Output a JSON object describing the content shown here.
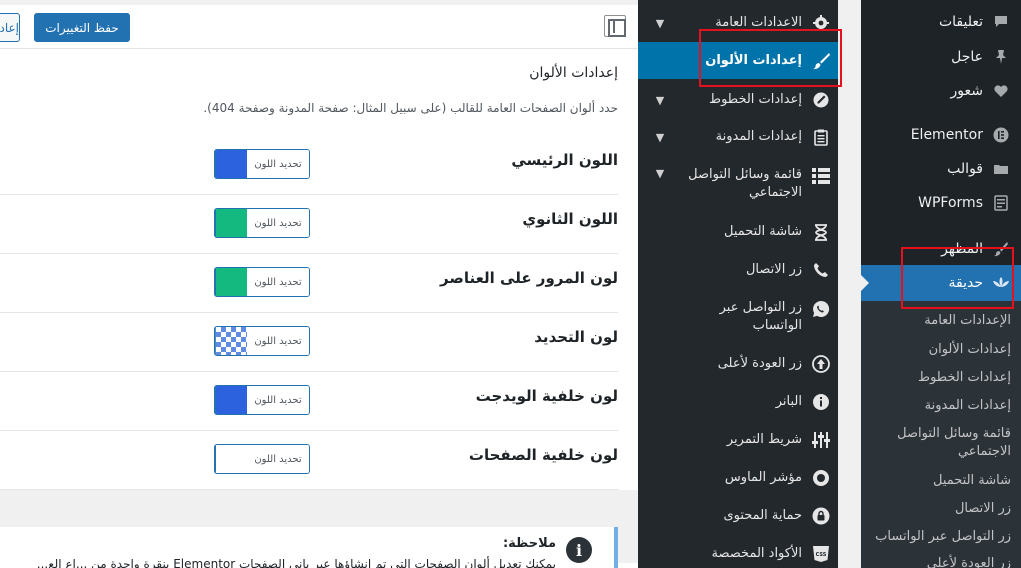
{
  "wp_sidebar": {
    "items": [
      {
        "label": "تعليقات",
        "icon": "comment-icon"
      },
      {
        "label": "عاجل",
        "icon": "pin-icon"
      },
      {
        "label": "شعور",
        "icon": "heart-icon"
      },
      {
        "label": "Elementor",
        "icon": "elementor-icon"
      },
      {
        "label": "قوالب",
        "icon": "folder-icon"
      },
      {
        "label": "WPForms",
        "icon": "forms-icon"
      },
      {
        "label": "المظهر",
        "icon": "brush-icon"
      }
    ],
    "active": {
      "label": "حديقة",
      "icon": "lotus-icon"
    },
    "submenu": [
      "الإعدادات العامة",
      "إعدادات الألوان",
      "إعدادات الخطوط",
      "إعدادات المدونة",
      "قائمة وسائل التواصل الاجتماعي",
      "شاشة التحميل",
      "زر الاتصال",
      "زر التواصل عبر الواتساب",
      "زر العودة لأعلى"
    ]
  },
  "panel_nav": [
    {
      "label": "الاعدادات العامة",
      "icon": "gear-icon",
      "chevron": true
    },
    {
      "label": "إعدادات الألوان",
      "icon": "brush-icon",
      "chevron": false,
      "active": true
    },
    {
      "label": "إعدادات الخطوط",
      "icon": "pen-icon",
      "chevron": true
    },
    {
      "label": "إعدادات المدونة",
      "icon": "clipboard-icon",
      "chevron": true
    },
    {
      "label": "قائمة وسائل التواصل الاجتماعي",
      "icon": "list-icon",
      "chevron": true
    },
    {
      "label": "شاشة التحميل",
      "icon": "hourglass-icon",
      "chevron": false
    },
    {
      "label": "زر الاتصال",
      "icon": "phone-icon",
      "chevron": false
    },
    {
      "label": "زر التواصل عبر الواتساب",
      "icon": "whatsapp-icon",
      "chevron": false
    },
    {
      "label": "زر العودة لأعلى",
      "icon": "arrow-up-circle-icon",
      "chevron": false
    },
    {
      "label": "البانر",
      "icon": "info-icon",
      "chevron": false
    },
    {
      "label": "شريط التمرير",
      "icon": "sliders-icon",
      "chevron": false
    },
    {
      "label": "مؤشر الماوس",
      "icon": "cursor-circle-icon",
      "chevron": false
    },
    {
      "label": "حماية المحتوى",
      "icon": "lock-icon",
      "chevron": false
    },
    {
      "label": "الأكواد المخصصة",
      "icon": "css-icon",
      "chevron": false
    }
  ],
  "toolbar": {
    "save_label": "حفظ التغييرات",
    "reset_label": "إعادة"
  },
  "section": {
    "title": "إعدادات الألوان",
    "description": "حدد ألوان الصفحات العامة للقالب (على سبيل المثال: صفحة المدونة وصفحة 404)."
  },
  "colors": {
    "picker_label": "تحديد اللون",
    "rows": [
      {
        "label": "اللون الرئيسي",
        "value": "#2d62de"
      },
      {
        "label": "اللون الثانوي",
        "value": "#14b980"
      },
      {
        "label": "لون المرور على العناصر",
        "value": "#14b980"
      },
      {
        "label": "لون التحديد",
        "value": "transparent"
      },
      {
        "label": "لون خلفية الويدجت",
        "value": "#2d62de"
      },
      {
        "label": "لون خلفية الصفحات",
        "value": "#ffffff"
      }
    ]
  },
  "note": {
    "title": "ملاحظة:",
    "text": "يمكنك تعديل ألوان الصفحات التي تم إنشاؤها عبر باني الصفحات Elementor بنقرة واحدة من ...اع الع..."
  }
}
